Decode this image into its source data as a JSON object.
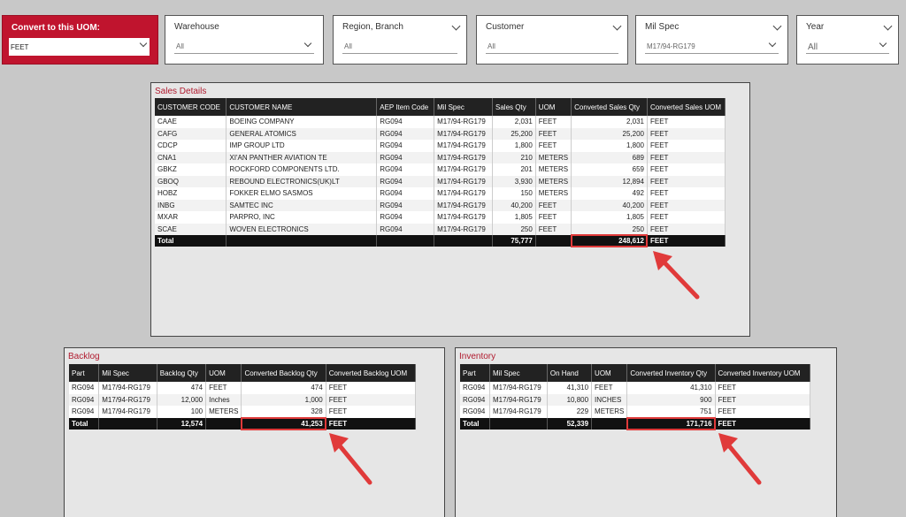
{
  "slicers": {
    "uom": {
      "title": "Convert to this UOM:",
      "value": "FEET"
    },
    "warehouse": {
      "title": "Warehouse",
      "value": "All"
    },
    "region": {
      "title": "Region, Branch",
      "value": "All"
    },
    "customer": {
      "title": "Customer",
      "value": "All"
    },
    "milspec": {
      "title": "Mil Spec",
      "value": "M17/94-RG179"
    },
    "year": {
      "title": "Year",
      "value": "All"
    }
  },
  "sales": {
    "title": "Sales Details",
    "headers": [
      "CUSTOMER CODE",
      "CUSTOMER NAME",
      "AEP Item Code",
      "Mil Spec",
      "Sales Qty",
      "UOM",
      "Converted Sales Qty",
      "Converted Sales UOM"
    ],
    "rows": [
      [
        "CAAE",
        "BOEING COMPANY",
        "RG094",
        "M17/94-RG179",
        "2,031",
        "FEET",
        "2,031",
        "FEET"
      ],
      [
        "CAFG",
        "GENERAL ATOMICS",
        "RG094",
        "M17/94-RG179",
        "25,200",
        "FEET",
        "25,200",
        "FEET"
      ],
      [
        "CDCP",
        "IMP GROUP LTD",
        "RG094",
        "M17/94-RG179",
        "1,800",
        "FEET",
        "1,800",
        "FEET"
      ],
      [
        "CNA1",
        "XI'AN PANTHER AVIATION TE",
        "RG094",
        "M17/94-RG179",
        "210",
        "METERS",
        "689",
        "FEET"
      ],
      [
        "GBKZ",
        "ROCKFORD COMPONENTS LTD.",
        "RG094",
        "M17/94-RG179",
        "201",
        "METERS",
        "659",
        "FEET"
      ],
      [
        "GBOQ",
        "REBOUND ELECTRONICS(UK)LT",
        "RG094",
        "M17/94-RG179",
        "3,930",
        "METERS",
        "12,894",
        "FEET"
      ],
      [
        "HOBZ",
        "FOKKER ELMO SASMOS",
        "RG094",
        "M17/94-RG179",
        "150",
        "METERS",
        "492",
        "FEET"
      ],
      [
        "INBG",
        "SAMTEC INC",
        "RG094",
        "M17/94-RG179",
        "40,200",
        "FEET",
        "40,200",
        "FEET"
      ],
      [
        "MXAR",
        "PARPRO, INC",
        "RG094",
        "M17/94-RG179",
        "1,805",
        "FEET",
        "1,805",
        "FEET"
      ],
      [
        "SCAE",
        "WOVEN ELECTRONICS",
        "RG094",
        "M17/94-RG179",
        "250",
        "FEET",
        "250",
        "FEET"
      ]
    ],
    "total": {
      "label": "Total",
      "sales_qty": "75,777",
      "converted_qty": "248,612",
      "converted_uom": "FEET"
    }
  },
  "backlog": {
    "title": "Backlog",
    "headers": [
      "Part",
      "Mil Spec",
      "Backlog Qty",
      "UOM",
      "Converted Backlog Qty",
      "Converted Backlog UOM"
    ],
    "rows": [
      [
        "RG094",
        "M17/94-RG179",
        "474",
        "FEET",
        "474",
        "FEET"
      ],
      [
        "RG094",
        "M17/94-RG179",
        "12,000",
        "Inches",
        "1,000",
        "FEET"
      ],
      [
        "RG094",
        "M17/94-RG179",
        "100",
        "METERS",
        "328",
        "FEET"
      ]
    ],
    "total": {
      "label": "Total",
      "qty": "12,574",
      "converted_qty": "41,253",
      "converted_uom": "FEET"
    }
  },
  "inventory": {
    "title": "Inventory",
    "headers": [
      "Part",
      "Mil Spec",
      "On Hand",
      "UOM",
      "Converted Inventory Qty",
      "Converted Inventory UOM"
    ],
    "rows": [
      [
        "RG094",
        "M17/94-RG179",
        "41,310",
        "FEET",
        "41,310",
        "FEET"
      ],
      [
        "RG094",
        "M17/94-RG179",
        "10,800",
        "INCHES",
        "900",
        "FEET"
      ],
      [
        "RG094",
        "M17/94-RG179",
        "229",
        "METERS",
        "751",
        "FEET"
      ]
    ],
    "total": {
      "label": "Total",
      "qty": "52,339",
      "converted_qty": "171,716",
      "converted_uom": "FEET"
    }
  },
  "colors": {
    "accent": "#c0142e",
    "highlight": "#e03a3a"
  }
}
